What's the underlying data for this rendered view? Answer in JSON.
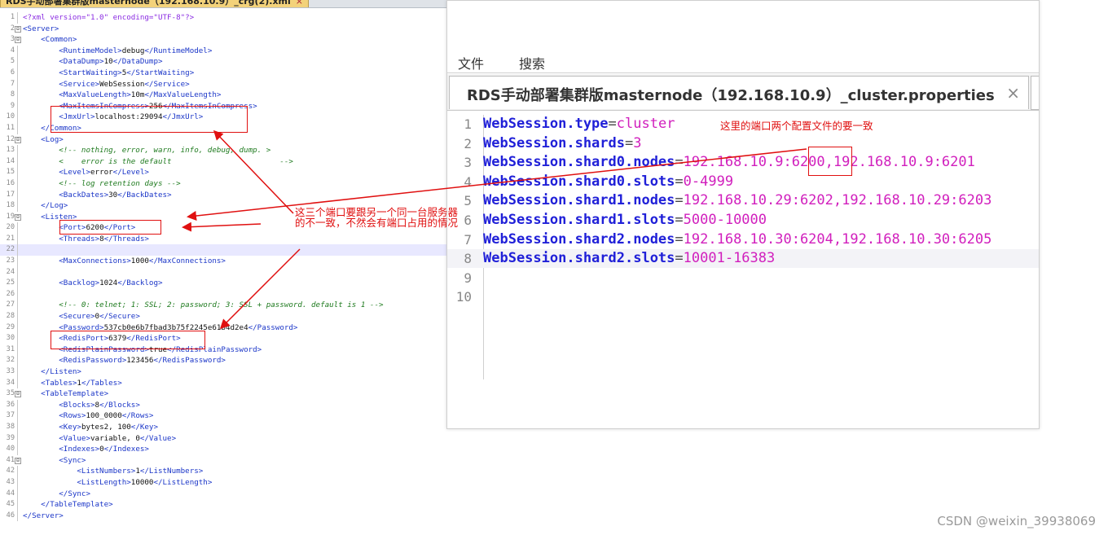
{
  "left_editor": {
    "tab_label": "RDS手动部署集群版masternode（192.168.10.9）_crg(2).xml",
    "tab_close": "×",
    "lines": [
      {
        "n": "1",
        "fold": "",
        "parts": [
          {
            "c": "pi",
            "t": "<?xml version=\"1.0\" encoding=\"UTF-8\"?>"
          }
        ]
      },
      {
        "n": "2",
        "fold": "⊟",
        "parts": [
          {
            "c": "tag",
            "t": "<Server>"
          }
        ]
      },
      {
        "n": "3",
        "fold": "⊟",
        "parts": [
          {
            "c": "txt",
            "t": "    "
          },
          {
            "c": "tag",
            "t": "<Common>"
          }
        ]
      },
      {
        "n": "4",
        "fold": "",
        "parts": [
          {
            "c": "txt",
            "t": "        "
          },
          {
            "c": "tag",
            "t": "<RuntimeModel>"
          },
          {
            "c": "txt",
            "t": "debug"
          },
          {
            "c": "tag",
            "t": "</RuntimeModel>"
          }
        ]
      },
      {
        "n": "5",
        "fold": "",
        "parts": [
          {
            "c": "txt",
            "t": "        "
          },
          {
            "c": "tag",
            "t": "<DataDump>"
          },
          {
            "c": "txt",
            "t": "10"
          },
          {
            "c": "tag",
            "t": "</DataDump>"
          }
        ]
      },
      {
        "n": "6",
        "fold": "",
        "parts": [
          {
            "c": "txt",
            "t": "        "
          },
          {
            "c": "tag",
            "t": "<StartWaiting>"
          },
          {
            "c": "txt",
            "t": "5"
          },
          {
            "c": "tag",
            "t": "</StartWaiting>"
          }
        ]
      },
      {
        "n": "7",
        "fold": "",
        "parts": [
          {
            "c": "txt",
            "t": "        "
          },
          {
            "c": "tag",
            "t": "<Service>"
          },
          {
            "c": "txt",
            "t": "WebSession"
          },
          {
            "c": "tag",
            "t": "</Service>"
          }
        ]
      },
      {
        "n": "8",
        "fold": "",
        "parts": [
          {
            "c": "txt",
            "t": "        "
          },
          {
            "c": "tag",
            "t": "<MaxValueLength>"
          },
          {
            "c": "txt",
            "t": "10m"
          },
          {
            "c": "tag",
            "t": "</MaxValueLength>"
          }
        ]
      },
      {
        "n": "9",
        "fold": "",
        "parts": [
          {
            "c": "txt",
            "t": "        "
          },
          {
            "c": "tag",
            "t": "<MaxItemsInCompress>"
          },
          {
            "c": "txt",
            "t": "256"
          },
          {
            "c": "tag",
            "t": "</MaxItemsInCompress>"
          }
        ]
      },
      {
        "n": "10",
        "fold": "",
        "parts": [
          {
            "c": "txt",
            "t": "        "
          },
          {
            "c": "tag",
            "t": "<JmxUrl>"
          },
          {
            "c": "txt",
            "t": "localhost:29094"
          },
          {
            "c": "tag",
            "t": "</JmxUrl>"
          }
        ]
      },
      {
        "n": "11",
        "fold": "",
        "parts": [
          {
            "c": "txt",
            "t": "    "
          },
          {
            "c": "tag",
            "t": "</Common>"
          }
        ]
      },
      {
        "n": "12",
        "fold": "⊟",
        "parts": [
          {
            "c": "txt",
            "t": "    "
          },
          {
            "c": "tag",
            "t": "<Log>"
          }
        ]
      },
      {
        "n": "13",
        "fold": "",
        "parts": [
          {
            "c": "txt",
            "t": "        "
          },
          {
            "c": "com",
            "t": "<!-- nothing, error, warn, info, debug, dump. >"
          }
        ]
      },
      {
        "n": "14",
        "fold": "",
        "parts": [
          {
            "c": "txt",
            "t": "        "
          },
          {
            "c": "com",
            "t": "<    error is the default                        -->"
          }
        ]
      },
      {
        "n": "15",
        "fold": "",
        "parts": [
          {
            "c": "txt",
            "t": "        "
          },
          {
            "c": "tag",
            "t": "<Level>"
          },
          {
            "c": "txt",
            "t": "error"
          },
          {
            "c": "tag",
            "t": "</Level>"
          }
        ]
      },
      {
        "n": "16",
        "fold": "",
        "parts": [
          {
            "c": "txt",
            "t": "        "
          },
          {
            "c": "com",
            "t": "<!-- log retention days -->"
          }
        ]
      },
      {
        "n": "17",
        "fold": "",
        "parts": [
          {
            "c": "txt",
            "t": "        "
          },
          {
            "c": "tag",
            "t": "<BackDates>"
          },
          {
            "c": "txt",
            "t": "30"
          },
          {
            "c": "tag",
            "t": "</BackDates>"
          }
        ]
      },
      {
        "n": "18",
        "fold": "",
        "parts": [
          {
            "c": "txt",
            "t": "    "
          },
          {
            "c": "tag",
            "t": "</Log>"
          }
        ]
      },
      {
        "n": "19",
        "fold": "⊟",
        "parts": [
          {
            "c": "txt",
            "t": "    "
          },
          {
            "c": "tag",
            "t": "<Listen>"
          }
        ]
      },
      {
        "n": "20",
        "fold": "",
        "parts": [
          {
            "c": "txt",
            "t": "        "
          },
          {
            "c": "tag",
            "t": "<Port>"
          },
          {
            "c": "txt",
            "t": "6200"
          },
          {
            "c": "tag",
            "t": "</Port>"
          }
        ]
      },
      {
        "n": "21",
        "fold": "",
        "parts": [
          {
            "c": "txt",
            "t": "        "
          },
          {
            "c": "tag",
            "t": "<Threads>"
          },
          {
            "c": "txt",
            "t": "8"
          },
          {
            "c": "tag",
            "t": "</Threads>"
          }
        ]
      },
      {
        "n": "22",
        "fold": "",
        "hl": true,
        "parts": []
      },
      {
        "n": "23",
        "fold": "",
        "parts": [
          {
            "c": "txt",
            "t": "        "
          },
          {
            "c": "tag",
            "t": "<MaxConnections>"
          },
          {
            "c": "txt",
            "t": "1000"
          },
          {
            "c": "tag",
            "t": "</MaxConnections>"
          }
        ]
      },
      {
        "n": "24",
        "fold": "",
        "parts": []
      },
      {
        "n": "25",
        "fold": "",
        "parts": [
          {
            "c": "txt",
            "t": "        "
          },
          {
            "c": "tag",
            "t": "<Backlog>"
          },
          {
            "c": "txt",
            "t": "1024"
          },
          {
            "c": "tag",
            "t": "</Backlog>"
          }
        ]
      },
      {
        "n": "26",
        "fold": "",
        "parts": []
      },
      {
        "n": "27",
        "fold": "",
        "parts": [
          {
            "c": "txt",
            "t": "        "
          },
          {
            "c": "com",
            "t": "<!-- 0: telnet; 1: SSL; 2: password; 3: SSL + password. default is 1 -->"
          }
        ]
      },
      {
        "n": "28",
        "fold": "",
        "parts": [
          {
            "c": "txt",
            "t": "        "
          },
          {
            "c": "tag",
            "t": "<Secure>"
          },
          {
            "c": "txt",
            "t": "0"
          },
          {
            "c": "tag",
            "t": "</Secure>"
          }
        ]
      },
      {
        "n": "29",
        "fold": "",
        "parts": [
          {
            "c": "txt",
            "t": "        "
          },
          {
            "c": "tag",
            "t": "<Password>"
          },
          {
            "c": "txt",
            "t": "537cb0e6b7fbad3b75f2245e61b4d2e4"
          },
          {
            "c": "tag",
            "t": "</Password>"
          }
        ]
      },
      {
        "n": "30",
        "fold": "",
        "parts": [
          {
            "c": "txt",
            "t": "        "
          },
          {
            "c": "tag",
            "t": "<RedisPort>"
          },
          {
            "c": "txt",
            "t": "6379"
          },
          {
            "c": "tag",
            "t": "</RedisPort>"
          }
        ]
      },
      {
        "n": "31",
        "fold": "",
        "parts": [
          {
            "c": "txt",
            "t": "        "
          },
          {
            "c": "tag",
            "t": "<RedisPlainPassword>"
          },
          {
            "c": "txt",
            "t": "true"
          },
          {
            "c": "tag",
            "t": "</RedisPlainPassword>"
          }
        ]
      },
      {
        "n": "32",
        "fold": "",
        "parts": [
          {
            "c": "txt",
            "t": "        "
          },
          {
            "c": "tag",
            "t": "<RedisPassword>"
          },
          {
            "c": "txt",
            "t": "123456"
          },
          {
            "c": "tag",
            "t": "</RedisPassword>"
          }
        ]
      },
      {
        "n": "33",
        "fold": "",
        "parts": [
          {
            "c": "txt",
            "t": "    "
          },
          {
            "c": "tag",
            "t": "</Listen>"
          }
        ]
      },
      {
        "n": "34",
        "fold": "",
        "parts": [
          {
            "c": "txt",
            "t": "    "
          },
          {
            "c": "tag",
            "t": "<Tables>"
          },
          {
            "c": "txt",
            "t": "1"
          },
          {
            "c": "tag",
            "t": "</Tables>"
          }
        ]
      },
      {
        "n": "35",
        "fold": "⊟",
        "parts": [
          {
            "c": "txt",
            "t": "    "
          },
          {
            "c": "tag",
            "t": "<TableTemplate>"
          }
        ]
      },
      {
        "n": "36",
        "fold": "",
        "parts": [
          {
            "c": "txt",
            "t": "        "
          },
          {
            "c": "tag",
            "t": "<Blocks>"
          },
          {
            "c": "txt",
            "t": "8"
          },
          {
            "c": "tag",
            "t": "</Blocks>"
          }
        ]
      },
      {
        "n": "37",
        "fold": "",
        "parts": [
          {
            "c": "txt",
            "t": "        "
          },
          {
            "c": "tag",
            "t": "<Rows>"
          },
          {
            "c": "txt",
            "t": "100_0000"
          },
          {
            "c": "tag",
            "t": "</Rows>"
          }
        ]
      },
      {
        "n": "38",
        "fold": "",
        "parts": [
          {
            "c": "txt",
            "t": "        "
          },
          {
            "c": "tag",
            "t": "<Key>"
          },
          {
            "c": "txt",
            "t": "bytes2, 100"
          },
          {
            "c": "tag",
            "t": "</Key>"
          }
        ]
      },
      {
        "n": "39",
        "fold": "",
        "parts": [
          {
            "c": "txt",
            "t": "        "
          },
          {
            "c": "tag",
            "t": "<Value>"
          },
          {
            "c": "txt",
            "t": "variable, 0"
          },
          {
            "c": "tag",
            "t": "</Value>"
          }
        ]
      },
      {
        "n": "40",
        "fold": "",
        "parts": [
          {
            "c": "txt",
            "t": "        "
          },
          {
            "c": "tag",
            "t": "<Indexes>"
          },
          {
            "c": "txt",
            "t": "0"
          },
          {
            "c": "tag",
            "t": "</Indexes>"
          }
        ]
      },
      {
        "n": "41",
        "fold": "⊟",
        "parts": [
          {
            "c": "txt",
            "t": "        "
          },
          {
            "c": "tag",
            "t": "<Sync>"
          }
        ]
      },
      {
        "n": "42",
        "fold": "",
        "parts": [
          {
            "c": "txt",
            "t": "            "
          },
          {
            "c": "tag",
            "t": "<ListNumbers>"
          },
          {
            "c": "txt",
            "t": "1"
          },
          {
            "c": "tag",
            "t": "</ListNumbers>"
          }
        ]
      },
      {
        "n": "43",
        "fold": "",
        "parts": [
          {
            "c": "txt",
            "t": "            "
          },
          {
            "c": "tag",
            "t": "<ListLength>"
          },
          {
            "c": "txt",
            "t": "10000"
          },
          {
            "c": "tag",
            "t": "</ListLength>"
          }
        ]
      },
      {
        "n": "44",
        "fold": "",
        "parts": [
          {
            "c": "txt",
            "t": "        "
          },
          {
            "c": "tag",
            "t": "</Sync>"
          }
        ]
      },
      {
        "n": "45",
        "fold": "",
        "parts": [
          {
            "c": "txt",
            "t": "    "
          },
          {
            "c": "tag",
            "t": "</TableTemplate>"
          }
        ]
      },
      {
        "n": "46",
        "fold": "",
        "parts": [
          {
            "c": "tag",
            "t": "</Server>"
          }
        ]
      }
    ]
  },
  "right_window": {
    "menu": {
      "file": "文件",
      "search": "搜索"
    },
    "tab_label": "RDS手动部署集群版masternode（192.168.10.9）_cluster.properties",
    "tab_close": "×",
    "lines": [
      {
        "n": "1",
        "key": "WebSession.type",
        "eq": "=",
        "val": "cluster"
      },
      {
        "n": "2",
        "key": "WebSession.shards",
        "eq": "=",
        "val": "3"
      },
      {
        "n": "3",
        "key": "WebSession.shard0.nodes",
        "eq": "=",
        "val": "192.168.10.9:6200,192.168.10.9:6201"
      },
      {
        "n": "4",
        "key": "WebSession.shard0.slots",
        "eq": "=",
        "val": "0-4999"
      },
      {
        "n": "5",
        "key": "WebSession.shard1.nodes",
        "eq": "=",
        "val": "192.168.10.29:6202,192.168.10.29:6203"
      },
      {
        "n": "6",
        "key": "WebSession.shard1.slots",
        "eq": "=",
        "val": "5000-10000"
      },
      {
        "n": "7",
        "key": "WebSession.shard2.nodes",
        "eq": "=",
        "val": "192.168.10.30:6204,192.168.10.30:6205"
      },
      {
        "n": "8",
        "key": "WebSession.shard2.slots",
        "eq": "=",
        "val": "10001-16383"
      },
      {
        "n": "9",
        "key": "",
        "eq": "",
        "val": ""
      },
      {
        "n": "10",
        "key": "",
        "eq": "",
        "val": ""
      }
    ]
  },
  "annotations": {
    "ports_consistent": "这里的端口两个配置文件的要一致",
    "three_ports_line1": "这三个端口要跟另一个同一台服务器",
    "three_ports_line2": "的不一致，不然会有端口占用的情况"
  },
  "watermark": "CSDN @weixin_39938069",
  "colors": {
    "annotation": "#e01010",
    "xml_tag": "#1b36c8",
    "prop_key": "#2020d8",
    "prop_value": "#d11fbd",
    "comment": "#1e7a1e"
  }
}
